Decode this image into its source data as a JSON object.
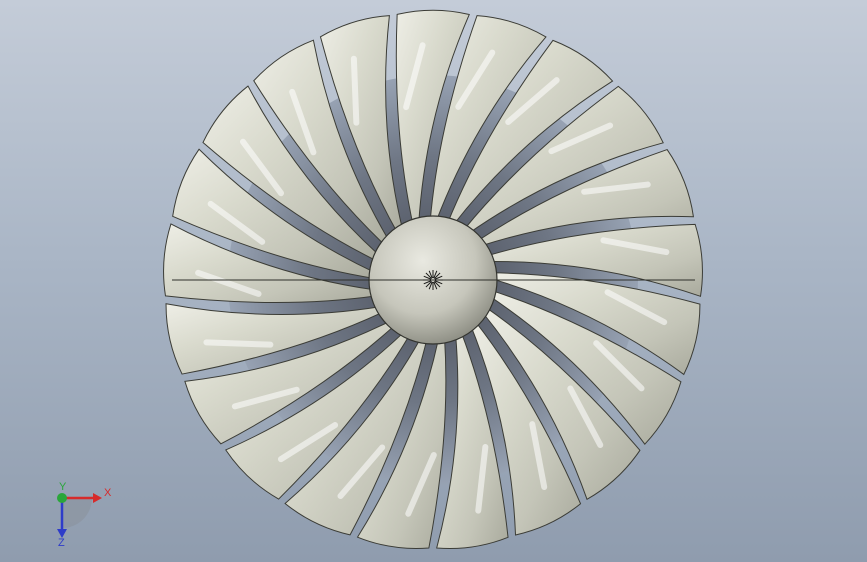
{
  "viewport": {
    "background_top": "#c4ccd8",
    "background_bottom": "#8f9cae"
  },
  "model": {
    "icon": "turbofan-fan-rotor",
    "blade_count": 21,
    "blade_color": "#d8d9cc",
    "blade_shadow": "#8b8c80",
    "hub_color": "#cfcfc4"
  },
  "triad": {
    "x_label": "X",
    "y_label": "Y",
    "z_label": "Z",
    "x_color": "#d62b2b",
    "y_color": "#2aa63a",
    "z_color": "#2e3cc9"
  }
}
